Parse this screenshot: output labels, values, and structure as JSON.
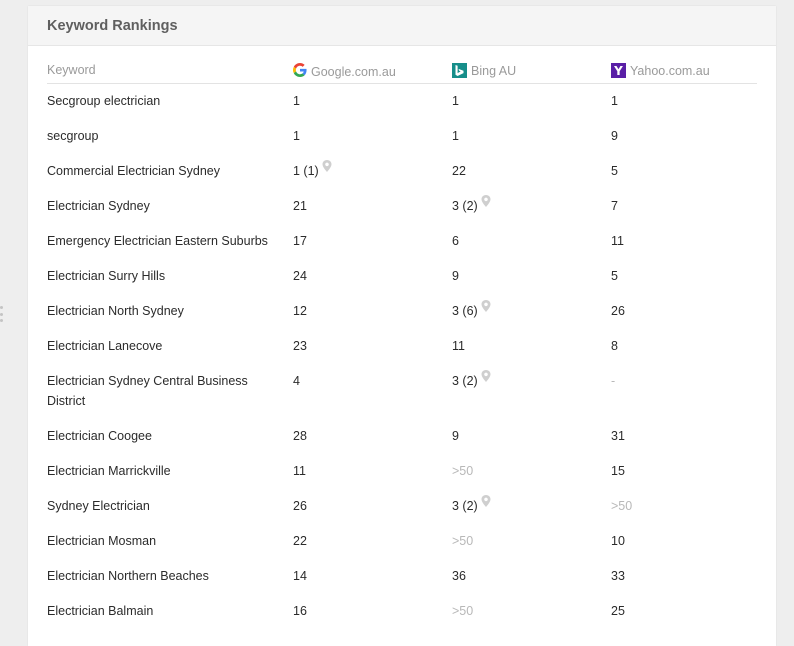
{
  "panel": {
    "title": "Keyword Rankings"
  },
  "table": {
    "headers": {
      "keyword": "Keyword",
      "google": "Google.com.au",
      "bing": "Bing AU",
      "yahoo": "Yahoo.com.au"
    },
    "icons": {
      "google": "google-logo-icon",
      "bing": "bing-logo-icon",
      "yahoo": "yahoo-logo-icon",
      "local_pack": "map-pin-icon"
    },
    "rows": [
      {
        "keyword": "Secgroup electrician",
        "google": "1",
        "bing": "1",
        "yahoo": "1"
      },
      {
        "keyword": "secgroup",
        "google": "1",
        "bing": "1",
        "yahoo": "9"
      },
      {
        "keyword": "Commercial Electrician Sydney",
        "google": "1 (1)",
        "google_pin": true,
        "bing": "22",
        "yahoo": "5"
      },
      {
        "keyword": "Electrician Sydney",
        "google": "21",
        "bing": "3 (2)",
        "bing_pin": true,
        "yahoo": "7"
      },
      {
        "keyword": "Emergency Electrician Eastern Suburbs",
        "google": "17",
        "bing": "6",
        "yahoo": "11"
      },
      {
        "keyword": "Electrician Surry Hills",
        "google": "24",
        "bing": "9",
        "yahoo": "5"
      },
      {
        "keyword": "Electrician North Sydney",
        "google": "12",
        "bing": "3 (6)",
        "bing_pin": true,
        "yahoo": "26"
      },
      {
        "keyword": "Electrician Lanecove",
        "google": "23",
        "bing": "11",
        "yahoo": "8"
      },
      {
        "keyword": "Electrician Sydney Central Business District",
        "google": "4",
        "bing": "3 (2)",
        "bing_pin": true,
        "yahoo": "-",
        "yahoo_muted": true
      },
      {
        "keyword": "Electrician Coogee",
        "google": "28",
        "bing": "9",
        "yahoo": "31"
      },
      {
        "keyword": "Electrician Marrickville",
        "google": "11",
        "bing": ">50",
        "bing_muted": true,
        "yahoo": "15"
      },
      {
        "keyword": "Sydney Electrician",
        "google": "26",
        "bing": "3 (2)",
        "bing_pin": true,
        "yahoo": ">50",
        "yahoo_muted": true
      },
      {
        "keyword": "Electrician Mosman",
        "google": "22",
        "bing": ">50",
        "bing_muted": true,
        "yahoo": "10"
      },
      {
        "keyword": "Electrician Northern Beaches",
        "google": "14",
        "bing": "36",
        "yahoo": "33"
      },
      {
        "keyword": "Electrician Balmain",
        "google": "16",
        "bing": ">50",
        "bing_muted": true,
        "yahoo": "25"
      }
    ]
  },
  "colors": {
    "bing_brand": "#168e8a",
    "yahoo_brand": "#5a1fa6",
    "muted_text": "#b8b8b8"
  }
}
